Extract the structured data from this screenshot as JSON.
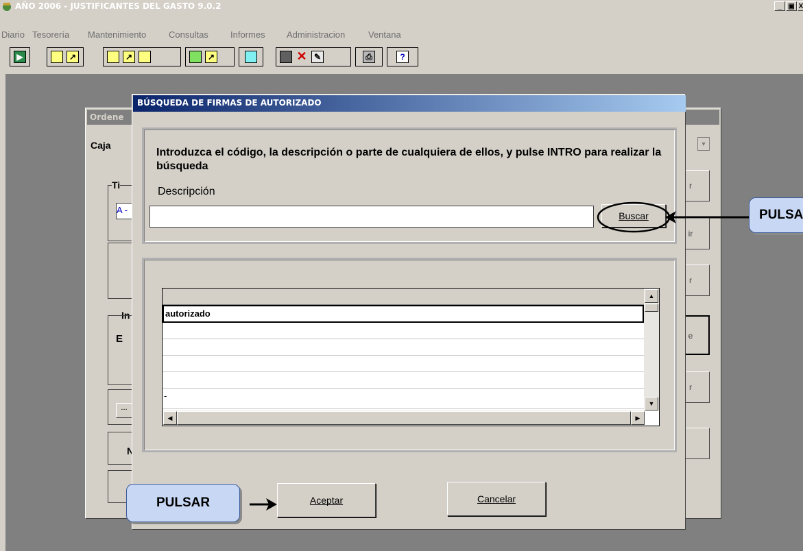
{
  "app": {
    "title": "AÑO 2006 - JUSTIFICANTES DEL GASTO 9.0.2",
    "window_buttons": [
      "_",
      "Đ",
      "X"
    ]
  },
  "menu": [
    "Diario",
    "Tesorería",
    "Mantenimiento",
    "Consultas",
    "Informes",
    "Administracion",
    "Ventana"
  ],
  "toolbar": {
    "help_glyph": "?"
  },
  "background_window": {
    "title": "Ordene",
    "caja_label": "Caja",
    "tipo_label": "Ti",
    "tipo_value": "A -",
    "importe_label": "In",
    "e_label": "E",
    "n_label": "N",
    "ellipsis": "...",
    "btn_labels": [
      "r",
      "ir",
      "r",
      "e",
      "r",
      ""
    ]
  },
  "dialog": {
    "title": "BÚSQUEDA DE FIRMAS DE AUTORIZADO",
    "instructions": "Introduzca el código, la descripción o parte de cualquiera de ellos, y pulse INTRO para realizar la búsqueda",
    "descripcion_label": "Descripción",
    "search_value": "",
    "buscar_label": "Buscar",
    "results": [
      "autorizado",
      "",
      "",
      "",
      "",
      "-"
    ],
    "aceptar_label": "Aceptar",
    "cancelar_label": "Cancelar"
  },
  "callouts": {
    "right": "PULSA",
    "bottom": "PULSAR"
  },
  "colors": {
    "title_gradient_start": "#0a246a",
    "title_gradient_end": "#a6caf0",
    "callout_fill": "#c8d8f4"
  }
}
